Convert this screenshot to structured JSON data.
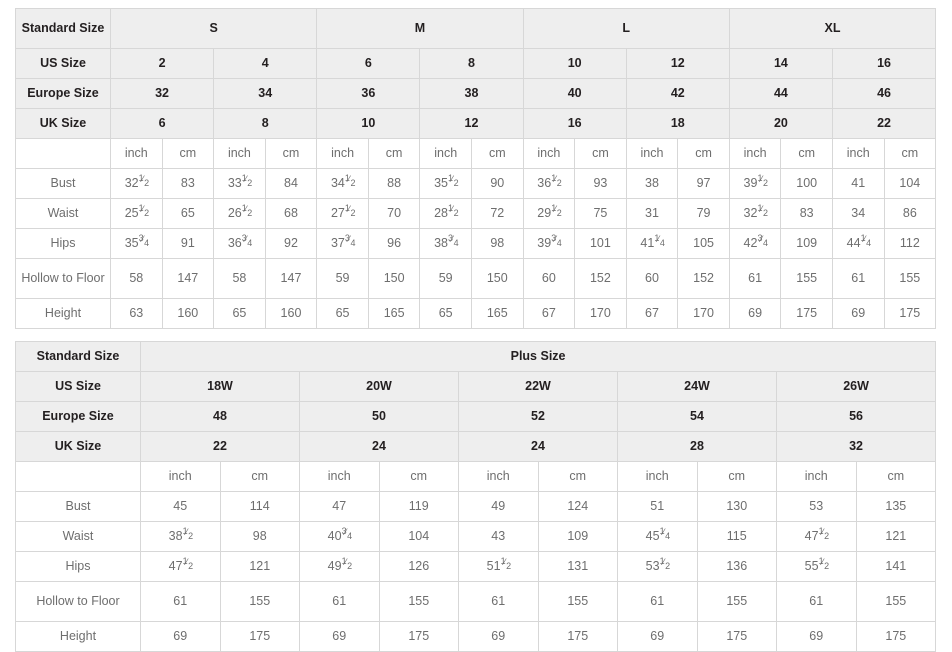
{
  "standard_table": {
    "label_col_header": "Standard Size",
    "group_headers": [
      {
        "label": "S",
        "span": 4
      },
      {
        "label": "M",
        "span": 4
      },
      {
        "label": "L",
        "span": 4
      },
      {
        "label": "XL",
        "span": 4
      }
    ],
    "size_rows": [
      {
        "label": "US Size",
        "values": [
          "2",
          "4",
          "6",
          "8",
          "10",
          "12",
          "14",
          "16"
        ]
      },
      {
        "label": "Europe Size",
        "values": [
          "32",
          "34",
          "36",
          "38",
          "40",
          "42",
          "44",
          "46"
        ]
      },
      {
        "label": "UK Size",
        "values": [
          "6",
          "8",
          "10",
          "12",
          "16",
          "18",
          "20",
          "22"
        ]
      }
    ],
    "unit_row": [
      "inch",
      "cm",
      "inch",
      "cm",
      "inch",
      "cm",
      "inch",
      "cm",
      "inch",
      "cm",
      "inch",
      "cm",
      "inch",
      "cm",
      "inch",
      "cm"
    ],
    "measure_rows": [
      {
        "label": "Bust",
        "values": [
          {
            "whole": "32",
            "num": "1",
            "den": "2"
          },
          "83",
          {
            "whole": "33",
            "num": "1",
            "den": "2"
          },
          "84",
          {
            "whole": "34",
            "num": "1",
            "den": "2"
          },
          "88",
          {
            "whole": "35",
            "num": "1",
            "den": "2"
          },
          "90",
          {
            "whole": "36",
            "num": "1",
            "den": "2"
          },
          "93",
          "38",
          "97",
          {
            "whole": "39",
            "num": "1",
            "den": "2"
          },
          "100",
          "41",
          "104"
        ]
      },
      {
        "label": "Waist",
        "values": [
          {
            "whole": "25",
            "num": "1",
            "den": "2"
          },
          "65",
          {
            "whole": "26",
            "num": "1",
            "den": "2"
          },
          "68",
          {
            "whole": "27",
            "num": "1",
            "den": "2"
          },
          "70",
          {
            "whole": "28",
            "num": "1",
            "den": "2"
          },
          "72",
          {
            "whole": "29",
            "num": "1",
            "den": "2"
          },
          "75",
          "31",
          "79",
          {
            "whole": "32",
            "num": "1",
            "den": "2"
          },
          "83",
          "34",
          "86"
        ]
      },
      {
        "label": "Hips",
        "values": [
          {
            "whole": "35",
            "num": "3",
            "den": "4"
          },
          "91",
          {
            "whole": "36",
            "num": "3",
            "den": "4"
          },
          "92",
          {
            "whole": "37",
            "num": "3",
            "den": "4"
          },
          "96",
          {
            "whole": "38",
            "num": "3",
            "den": "4"
          },
          "98",
          {
            "whole": "39",
            "num": "3",
            "den": "4"
          },
          "101",
          {
            "whole": "41",
            "num": "1",
            "den": "4"
          },
          "105",
          {
            "whole": "42",
            "num": "3",
            "den": "4"
          },
          "109",
          {
            "whole": "44",
            "num": "1",
            "den": "4"
          },
          "112"
        ]
      },
      {
        "label": "Hollow to Floor",
        "tall": true,
        "values": [
          "58",
          "147",
          "58",
          "147",
          "59",
          "150",
          "59",
          "150",
          "60",
          "152",
          "60",
          "152",
          "61",
          "155",
          "61",
          "155"
        ]
      },
      {
        "label": "Height",
        "values": [
          "63",
          "160",
          "65",
          "160",
          "65",
          "165",
          "65",
          "165",
          "67",
          "170",
          "67",
          "170",
          "69",
          "175",
          "69",
          "175"
        ]
      }
    ]
  },
  "plus_table": {
    "label_col_header": "Standard Size",
    "group_header": "Plus Size",
    "size_rows": [
      {
        "label": "US Size",
        "values": [
          "18W",
          "20W",
          "22W",
          "24W",
          "26W"
        ]
      },
      {
        "label": "Europe Size",
        "values": [
          "48",
          "50",
          "52",
          "54",
          "56"
        ]
      },
      {
        "label": "UK Size",
        "values": [
          "22",
          "24",
          "24",
          "28",
          "32"
        ]
      }
    ],
    "unit_row": [
      "inch",
      "cm",
      "inch",
      "cm",
      "inch",
      "cm",
      "inch",
      "cm",
      "inch",
      "cm"
    ],
    "measure_rows": [
      {
        "label": "Bust",
        "values": [
          "45",
          "114",
          "47",
          "119",
          "49",
          "124",
          "51",
          "130",
          "53",
          "135"
        ]
      },
      {
        "label": "Waist",
        "values": [
          {
            "whole": "38",
            "num": "1",
            "den": "2"
          },
          "98",
          {
            "whole": "40",
            "num": "3",
            "den": "4"
          },
          "104",
          "43",
          "109",
          {
            "whole": "45",
            "num": "1",
            "den": "4"
          },
          "115",
          {
            "whole": "47",
            "num": "1",
            "den": "2"
          },
          "121"
        ]
      },
      {
        "label": "Hips",
        "values": [
          {
            "whole": "47",
            "num": "1",
            "den": "2"
          },
          "121",
          {
            "whole": "49",
            "num": "1",
            "den": "2"
          },
          "126",
          {
            "whole": "51",
            "num": "1",
            "den": "2"
          },
          "131",
          {
            "whole": "53",
            "num": "1",
            "den": "2"
          },
          "136",
          {
            "whole": "55",
            "num": "1",
            "den": "2"
          },
          "141"
        ]
      },
      {
        "label": "Hollow to Floor",
        "tall": true,
        "values": [
          "61",
          "155",
          "61",
          "155",
          "61",
          "155",
          "61",
          "155",
          "61",
          "155"
        ]
      },
      {
        "label": "Height",
        "values": [
          "69",
          "175",
          "69",
          "175",
          "69",
          "175",
          "69",
          "175",
          "69",
          "175"
        ]
      }
    ]
  },
  "colors": {
    "header_fill": "#eeeeee",
    "cell_fill": "#ffffff",
    "border": "#d7d7d7",
    "header_text": "#231f20",
    "cell_text": "#6e6e6e",
    "unit_text": "#9a9a9a"
  }
}
